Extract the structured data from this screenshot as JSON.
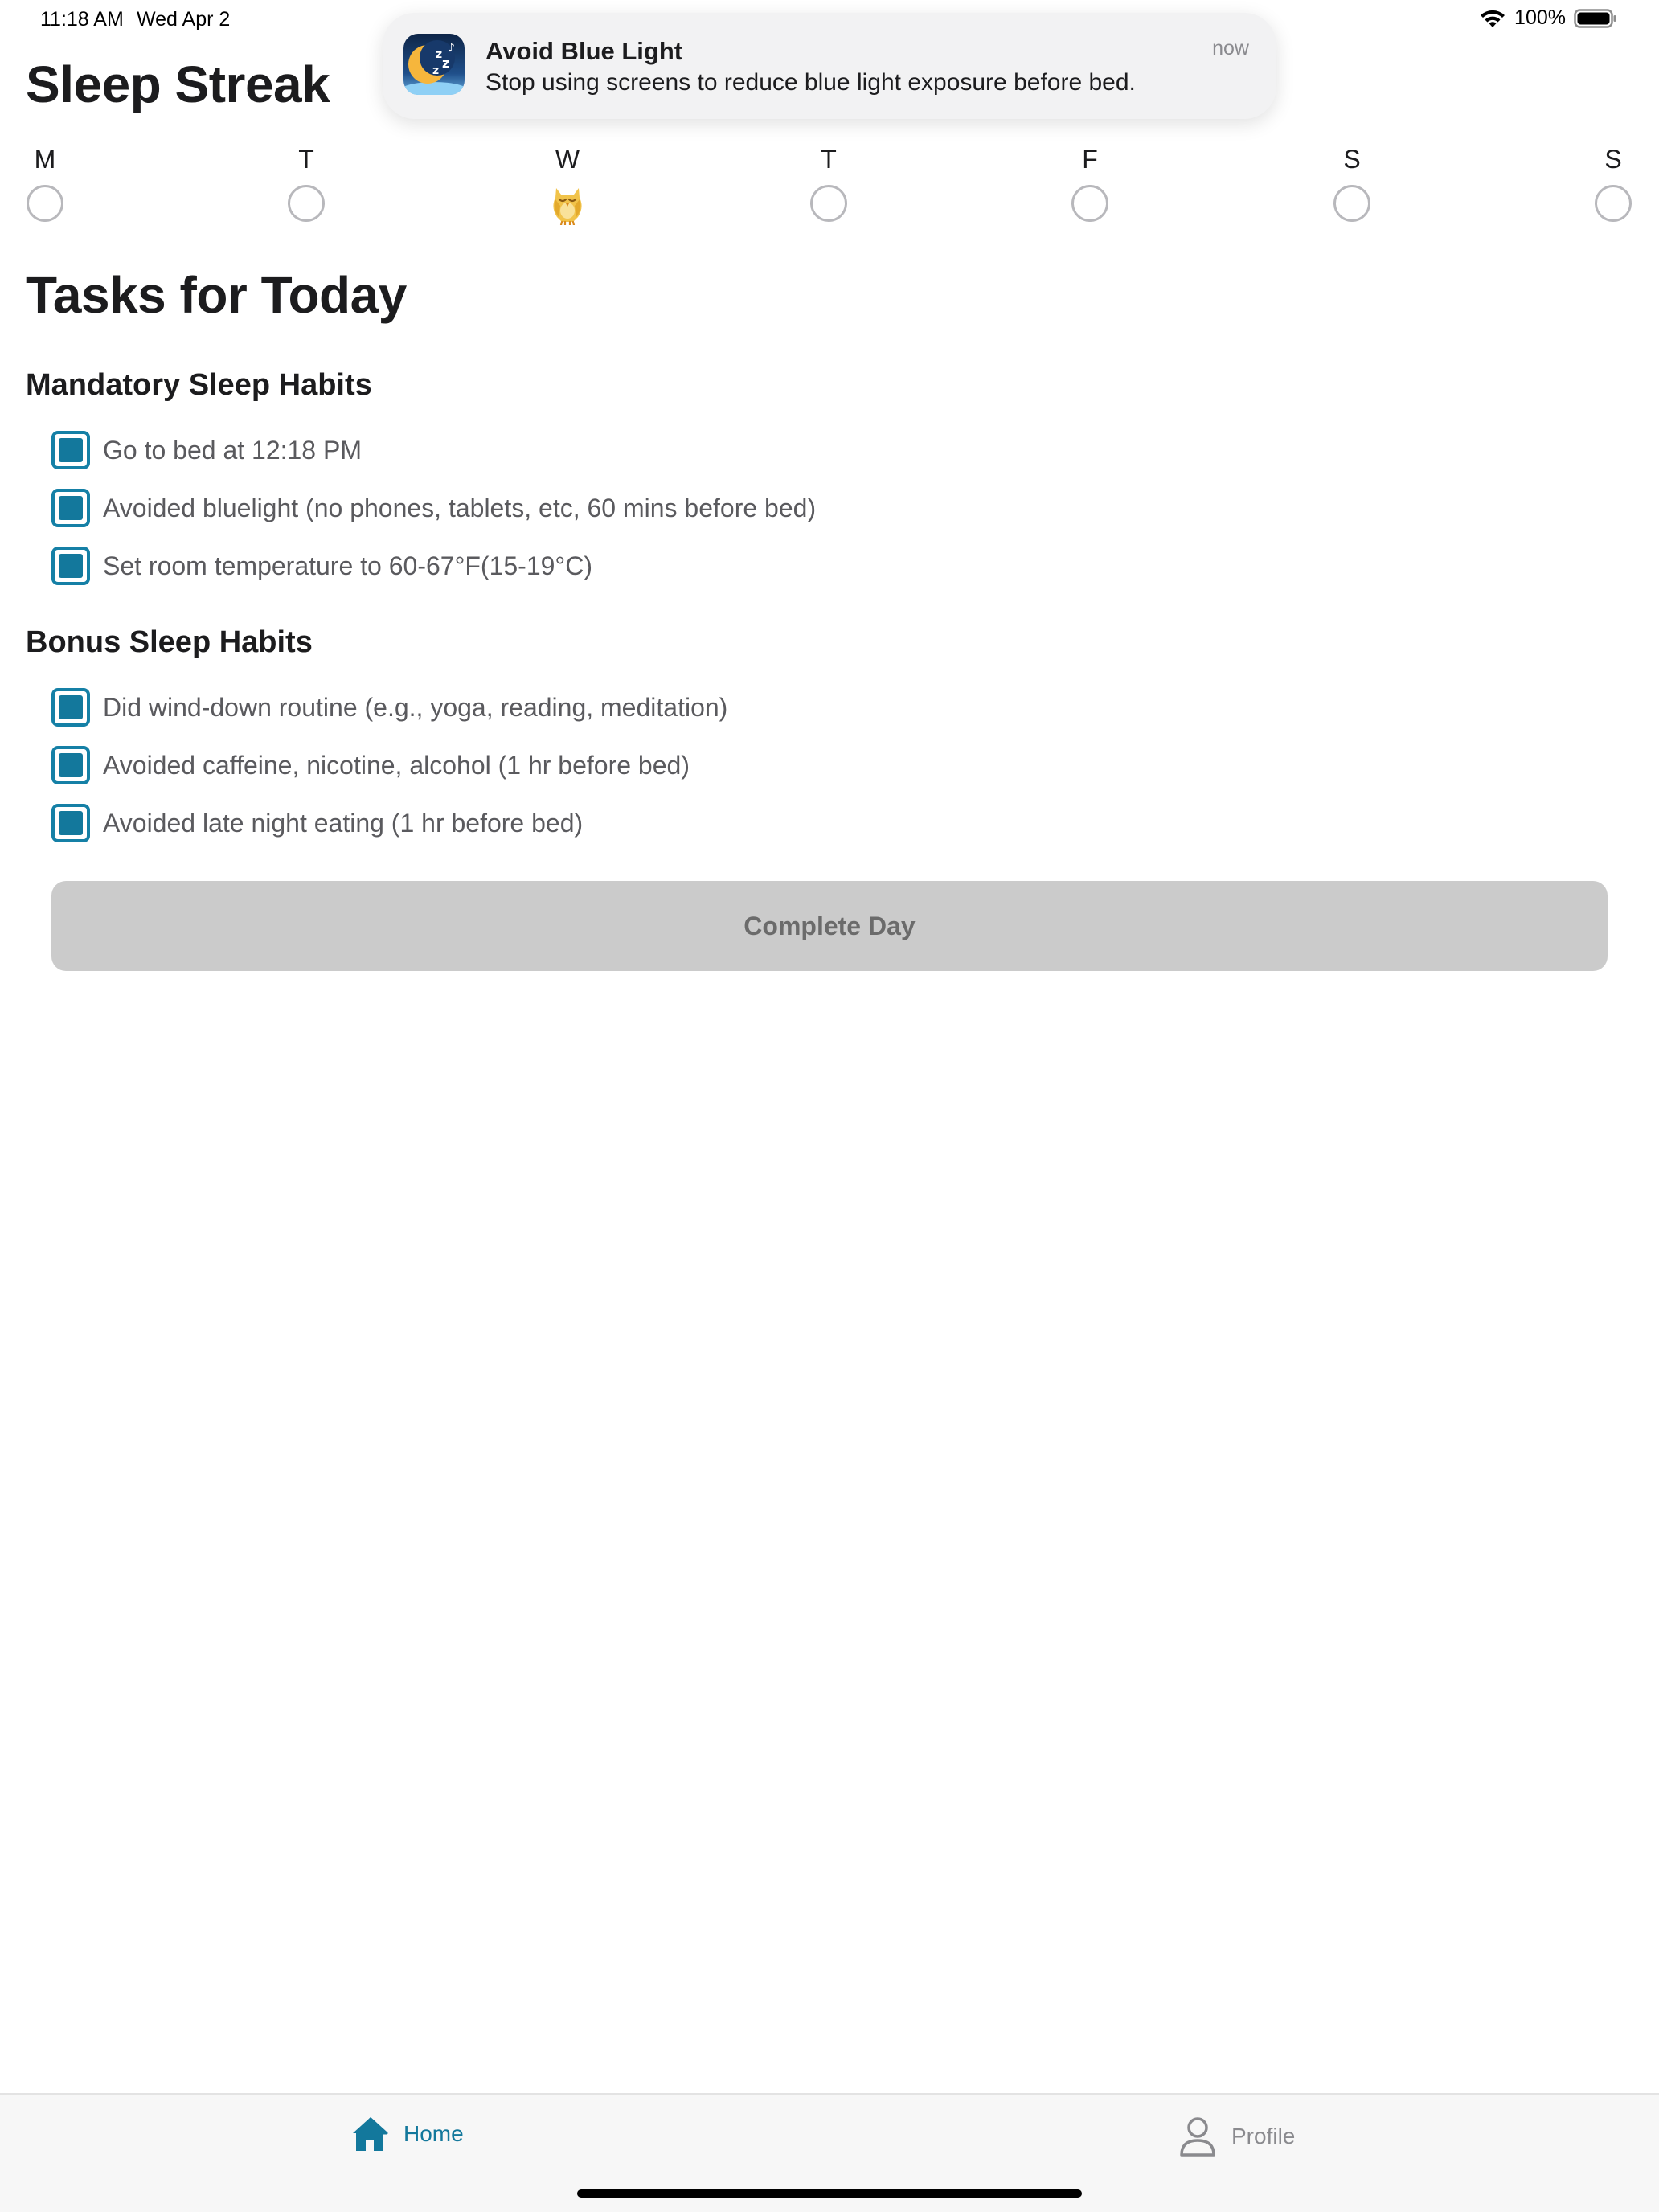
{
  "status_bar": {
    "time": "11:18 AM",
    "date": "Wed Apr 2",
    "battery": "100%"
  },
  "app": {
    "title": "Sleep Streak"
  },
  "notification": {
    "title": "Avoid Blue Light",
    "body": "Stop using screens to reduce blue light exposure before bed.",
    "time": "now",
    "icon": "moon-zzz-app-icon"
  },
  "week": {
    "days": [
      "M",
      "T",
      "W",
      "T",
      "F",
      "S",
      "S"
    ],
    "status": [
      "empty",
      "empty",
      "owl",
      "empty",
      "empty",
      "empty",
      "empty"
    ]
  },
  "tasks": {
    "title": "Tasks for Today",
    "mandatory": {
      "title": "Mandatory Sleep Habits",
      "items": [
        {
          "label": "Go to bed at 12:18 PM",
          "checked": true
        },
        {
          "label": "Avoided bluelight (no phones, tablets, etc, 60 mins before bed)",
          "checked": true
        },
        {
          "label": "Set room temperature to 60-67°F(15-19°C)",
          "checked": true
        }
      ]
    },
    "bonus": {
      "title": "Bonus Sleep Habits",
      "items": [
        {
          "label": "Did wind-down routine (e.g., yoga, reading, meditation)",
          "checked": true
        },
        {
          "label": "Avoided caffeine, nicotine, alcohol (1 hr before bed)",
          "checked": true
        },
        {
          "label": "Avoided late night eating (1 hr before bed)",
          "checked": true
        }
      ]
    },
    "complete_button": "Complete Day"
  },
  "tab_bar": {
    "home": "Home",
    "profile": "Profile",
    "active": "home"
  },
  "colors": {
    "accent": "#13789c",
    "button_disabled": "#cbcbcb",
    "text_secondary": "#5a5a5e"
  }
}
